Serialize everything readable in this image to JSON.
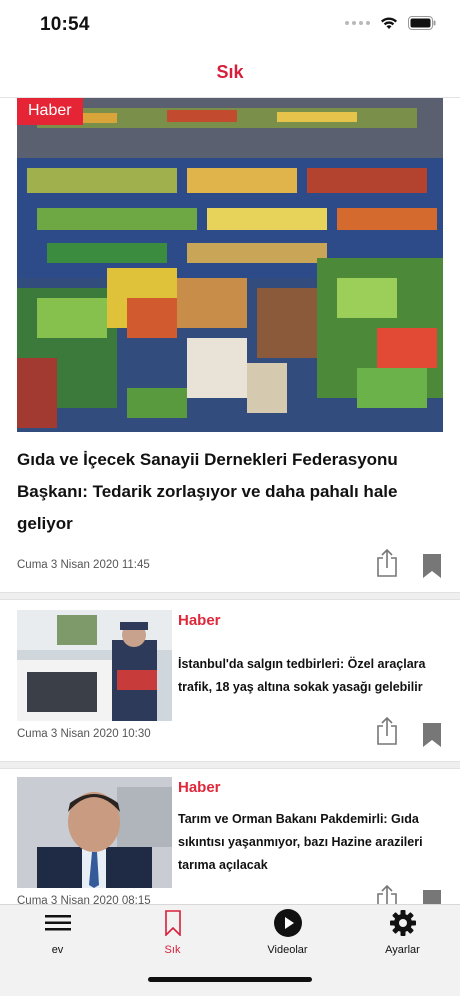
{
  "status": {
    "time": "10:54"
  },
  "header": {
    "title": "Sık"
  },
  "hero": {
    "category": "Haber",
    "title": "Gıda ve İçecek Sanayii Dernekleri Federasyonu Başkanı: Tedarik zorlaşıyor ve daha pahalı hale geliyor",
    "date": "Cuma 3 Nisan 2020 11:45"
  },
  "articles": [
    {
      "category": "Haber",
      "title": "İstanbul'da salgın tedbirleri: Özel araçlara trafik, 18 yaş altına sokak yasağı gelebilir",
      "date": "Cuma 3 Nisan 2020 10:30"
    },
    {
      "category": "Haber",
      "title": "Tarım ve Orman Bakanı Pakdemirli: Gıda sıkıntısı yaşanmıyor, bazı Hazine arazileri tarıma açılacak",
      "date": "Cuma 3 Nisan 2020 08:15"
    }
  ],
  "tabs": [
    {
      "label": "ev",
      "icon": "list-icon"
    },
    {
      "label": "Sık",
      "icon": "bookmark-icon"
    },
    {
      "label": "Videolar",
      "icon": "play-icon"
    },
    {
      "label": "Ayarlar",
      "icon": "gear-icon"
    }
  ],
  "colors": {
    "accent": "#d71f3b",
    "badge": "#e52535",
    "icon_gray": "#777777"
  }
}
